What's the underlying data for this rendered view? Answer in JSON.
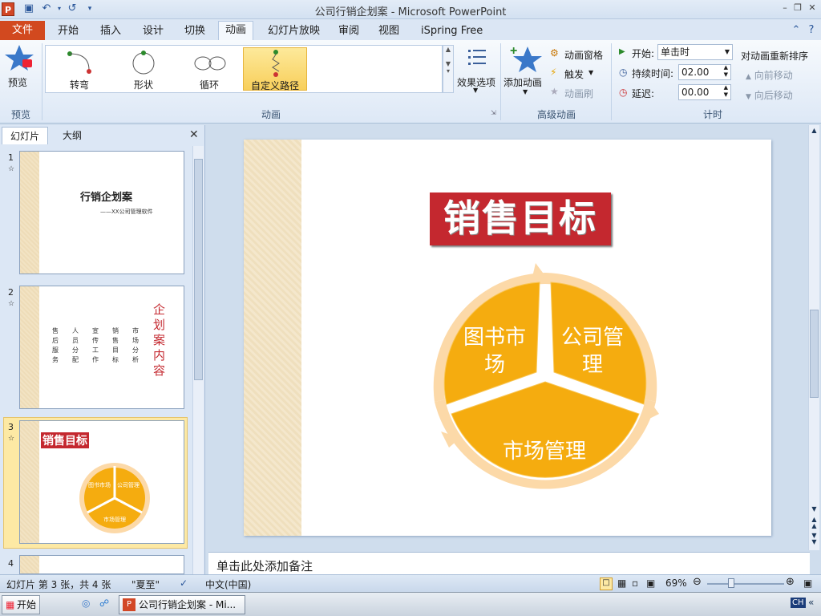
{
  "window": {
    "title": "公司行销企划案 - Microsoft PowerPoint"
  },
  "ribbon_tabs": [
    "开始",
    "插入",
    "设计",
    "切换",
    "动画",
    "幻灯片放映",
    "审阅",
    "视图",
    "iSpring Free"
  ],
  "file_tab": "文件",
  "preview": {
    "label": "预览",
    "group": "预览"
  },
  "animation_gallery": [
    {
      "label": "转弯"
    },
    {
      "label": "形状"
    },
    {
      "label": "循环"
    },
    {
      "label": "自定义路径",
      "selected": true
    }
  ],
  "effect_options": "效果选项",
  "animation_group": "动画",
  "advanced": {
    "add_animation": "添加动画",
    "animation_pane": "动画窗格",
    "trigger": "触发",
    "animation_painter": "动画刷",
    "group": "高级动画"
  },
  "timing": {
    "start_label": "开始:",
    "start_value": "单击时",
    "duration_label": "持续时间:",
    "duration_value": "02.00",
    "delay_label": "延迟:",
    "delay_value": "00.00",
    "reorder_title": "对动画重新排序",
    "move_earlier": "向前移动",
    "move_later": "向后移动",
    "group": "计时"
  },
  "panel": {
    "tab_slides": "幻灯片",
    "tab_outline": "大纲"
  },
  "thumbnails": {
    "s1": {
      "num": "1",
      "title": "行销企划案",
      "subtitle": "——XX公司管理软件"
    },
    "s2": {
      "num": "2",
      "title": "企划案内容",
      "cols": [
        "售后服务",
        "人员分配",
        "宣传工作",
        "销售目标",
        "市场分析"
      ]
    },
    "s3": {
      "num": "3",
      "title": "销售目标",
      "a": "图书市场",
      "b": "公司管理",
      "c": "市场管理"
    },
    "s4": {
      "num": "4"
    }
  },
  "slide": {
    "title": "销售目标",
    "segments": {
      "left_1": "图书市",
      "left_2": "场",
      "right_1": "公司管",
      "right_2": "理",
      "bottom": "市场管理"
    }
  },
  "notes_placeholder": "单击此处添加备注",
  "status": {
    "slide_info": "幻灯片 第 3 张，共 4 张",
    "theme": "\"夏至\"",
    "language": "中文(中国)",
    "zoom": "69%"
  },
  "taskbar": {
    "start": "开始",
    "item": "公司行销企划案 - Mi...",
    "ime": "CH"
  },
  "colors": {
    "accent_orange": "#f5ac0f",
    "file_tab": "#d2491f",
    "title_red": "#c4282f",
    "ring": "#fcd9a8"
  }
}
